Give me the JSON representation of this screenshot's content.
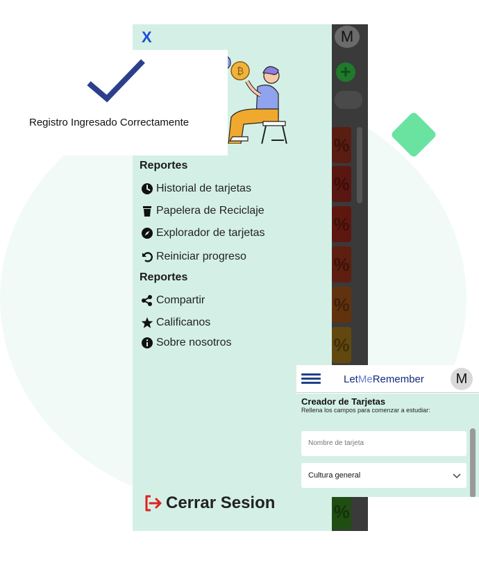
{
  "drawer": {
    "close_label": "X",
    "section_1_title": "Reportes",
    "section_2_title": "Reportes",
    "items_1": [
      {
        "label": "Historial de tarjetas",
        "icon": "clock-icon"
      },
      {
        "label": "Papelera de Reciclaje",
        "icon": "trash-icon"
      },
      {
        "label": "Explorador de tarjetas",
        "icon": "compass-icon"
      },
      {
        "label": "Reiniciar progreso",
        "icon": "undo-icon"
      }
    ],
    "items_2": [
      {
        "label": "Compartir",
        "icon": "share-icon"
      },
      {
        "label": "Calificanos",
        "icon": "star-icon"
      },
      {
        "label": "Sobre nosotros",
        "icon": "info-icon"
      }
    ],
    "logout_label": "Cerrar Sesion",
    "logout_color": "#e02020"
  },
  "toast": {
    "message": "Registro Ingresado Correctamente",
    "check_color": "#2c3f8c"
  },
  "behind_app": {
    "avatar_letter": "M",
    "tile_glyph": "%"
  },
  "inset_app": {
    "brand_let": "Let",
    "brand_me": "Me",
    "brand_remember": "Remember",
    "avatar_letter": "M",
    "heading": "Creador de Tarjetas",
    "subheading": "Rellena los campos para comenzar a estudiar:",
    "name_placeholder": "Nombre de tarjeta",
    "category_selected": "Cultura general"
  }
}
